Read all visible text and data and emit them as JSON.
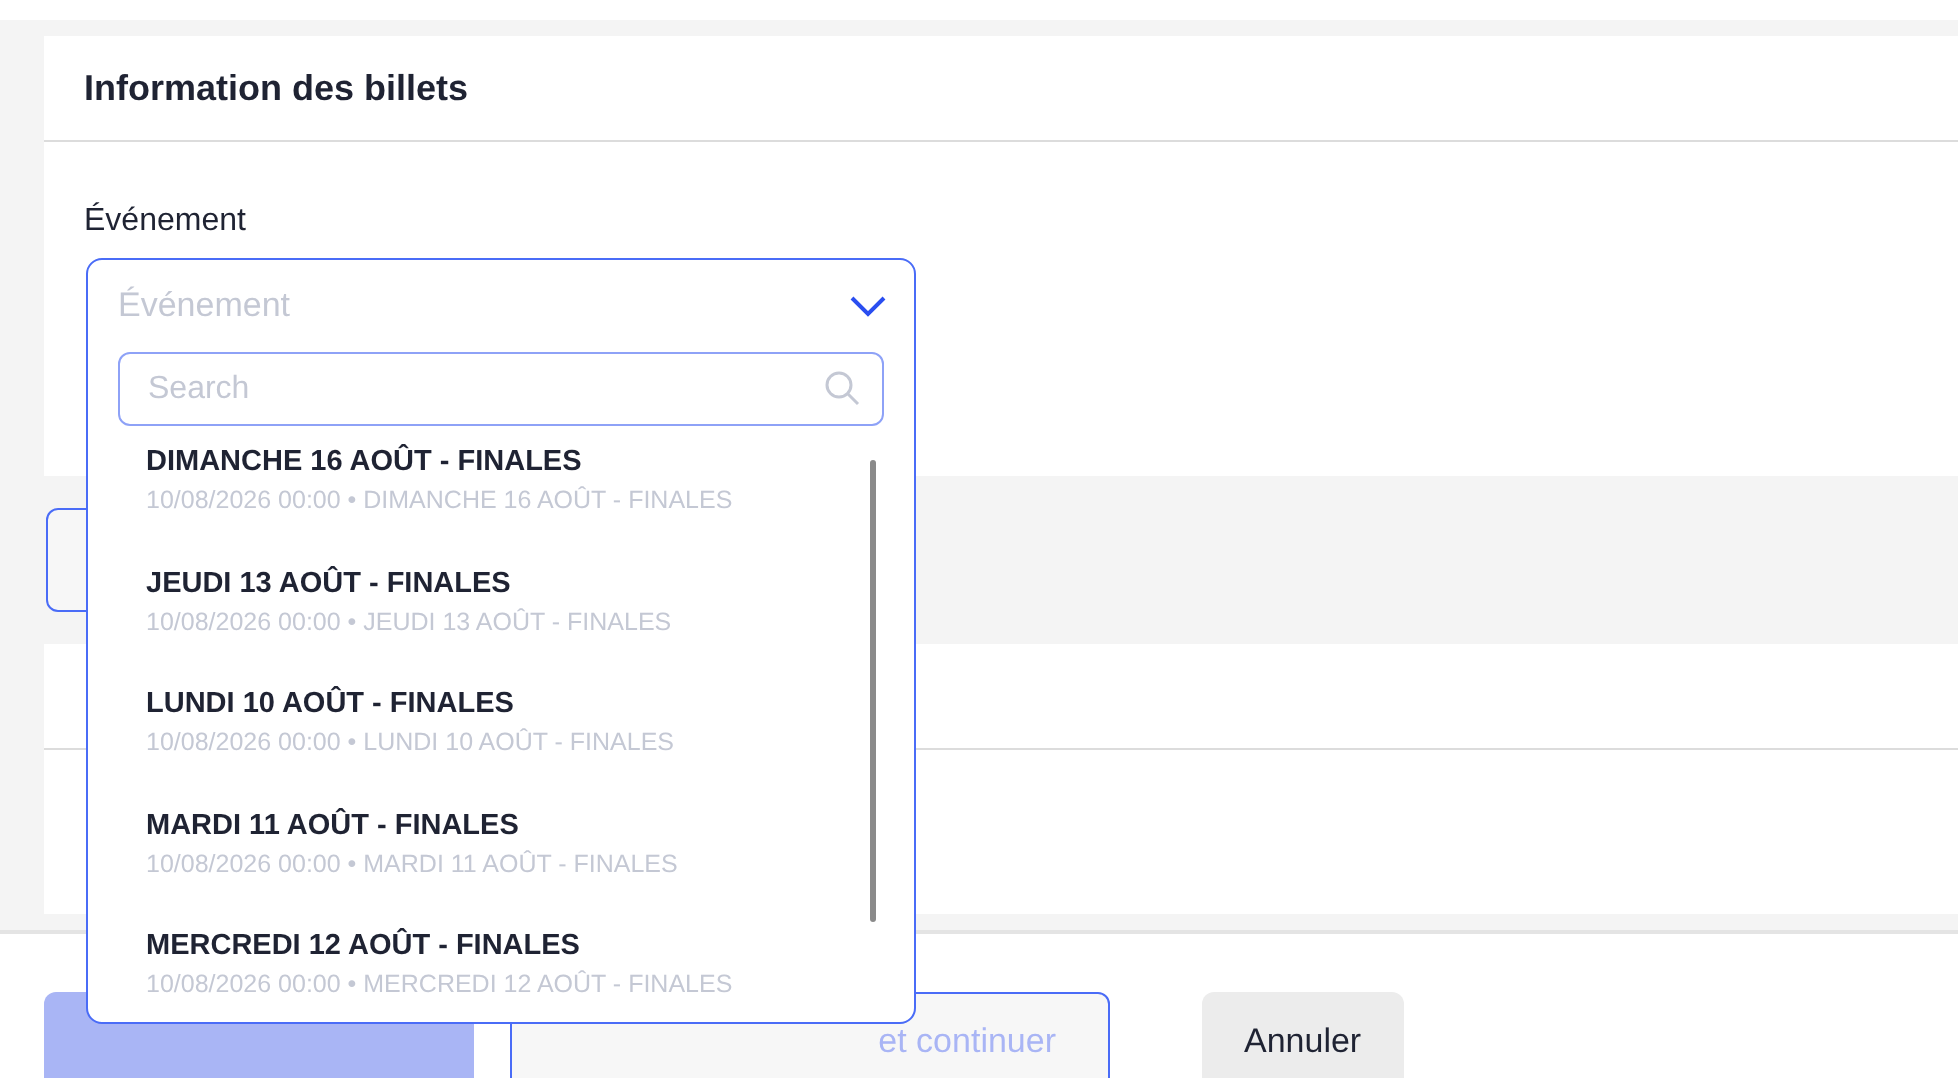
{
  "section": {
    "title": "Information des billets"
  },
  "field": {
    "label": "Événement"
  },
  "dropdown": {
    "placeholder": "Événement",
    "expanded": true,
    "search": {
      "placeholder": "Search"
    },
    "options": [
      {
        "title": "DIMANCHE 16 AOÛT - FINALES",
        "subtitle": "10/08/2026 00:00 • DIMANCHE 16 AOÛT - FINALES"
      },
      {
        "title": "JEUDI 13 AOÛT - FINALES",
        "subtitle": "10/08/2026 00:00 • JEUDI 13 AOÛT - FINALES"
      },
      {
        "title": "LUNDI 10 AOÛT - FINALES",
        "subtitle": "10/08/2026 00:00 • LUNDI 10 AOÛT - FINALES"
      },
      {
        "title": "MARDI 11 AOÛT - FINALES",
        "subtitle": "10/08/2026 00:00 • MARDI 11 AOÛT - FINALES"
      },
      {
        "title": "MERCREDI 12 AOÛT - FINALES",
        "subtitle": "10/08/2026 00:00 • MERCREDI 12 AOÛT - FINALES"
      }
    ]
  },
  "footer": {
    "buttons": [
      {
        "kind": "primary",
        "disabled": true
      },
      {
        "kind": "outline",
        "label": "et continuer",
        "disabled": true
      },
      {
        "kind": "secondary",
        "label": "Annuler",
        "disabled": false
      }
    ]
  }
}
